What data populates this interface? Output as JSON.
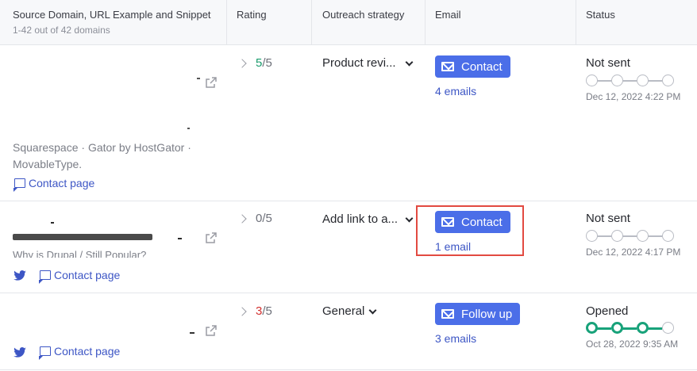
{
  "header": {
    "col_source_title": "Source Domain, URL Example and Snippet",
    "col_source_sub": "1-42 out of 42 domains",
    "col_rating": "Rating",
    "col_outreach": "Outreach strategy",
    "col_email": "Email",
    "col_status": "Status"
  },
  "rows": [
    {
      "rating_value": "5",
      "rating_max": "/5",
      "outreach": "Product revi...",
      "email_button": "Contact",
      "email_count": "4 emails",
      "status": "Not sent",
      "steps_completed": 0,
      "date": "Dec 12, 2022 4:22 PM",
      "snippet_line1": "Squarespace · Gator by HostGator ·",
      "snippet_line2": "MovableType.",
      "contact_page": "Contact page"
    },
    {
      "rating_value": "0",
      "rating_max": "/5",
      "outreach": "Add link to a...",
      "email_button": "Contact",
      "email_count": "1 email",
      "status": "Not sent",
      "steps_completed": 0,
      "date": "Dec 12, 2022 4:17 PM",
      "snippet_line1": "Why is Drupal / Still Popular?",
      "contact_page": "Contact page"
    },
    {
      "rating_value": "3",
      "rating_max": "/5",
      "outreach": "General",
      "email_button": "Follow up",
      "email_count": "3 emails",
      "status": "Opened",
      "steps_completed": 3,
      "date": "Oct 28, 2022 9:35 AM",
      "contact_page": "Contact page"
    }
  ],
  "colors": {
    "accent": "#4b6ee8",
    "link": "#3d56c5",
    "rating_good": "#1a9b6c",
    "rating_bad": "#d2302f",
    "step_done": "#18a27a",
    "highlight": "#e24a41"
  },
  "icons": [
    "chevron-right-icon",
    "caret-down-icon",
    "envelope-icon",
    "external-link-icon",
    "chat-bubble-icon",
    "twitter-icon"
  ]
}
